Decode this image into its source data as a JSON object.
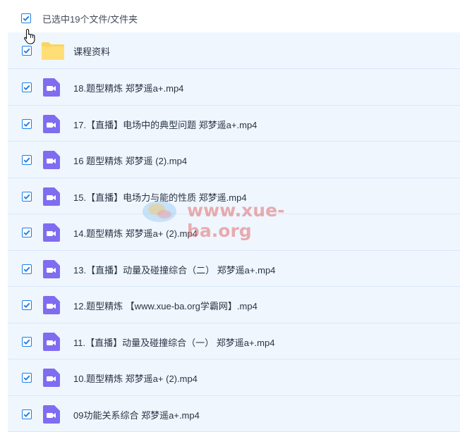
{
  "header": {
    "select_label": "已选中19个文件/文件夹"
  },
  "files": [
    {
      "name": "课程资料",
      "type": "folder"
    },
    {
      "name": "18.题型精炼 郑梦遥a+.mp4",
      "type": "video"
    },
    {
      "name": "17.【直播】电场中的典型问题 郑梦遥a+.mp4",
      "type": "video"
    },
    {
      "name": "16 题型精炼 郑梦遥 (2).mp4",
      "type": "video"
    },
    {
      "name": "15.【直播】电场力与能的性质 郑梦遥.mp4",
      "type": "video"
    },
    {
      "name": "14.题型精炼 郑梦遥a+ (2).mp4",
      "type": "video"
    },
    {
      "name": "13.【直播】动量及碰撞综合（二） 郑梦遥a+.mp4",
      "type": "video"
    },
    {
      "name": "12.题型精炼 【www.xue-ba.org学霸网】.mp4",
      "type": "video"
    },
    {
      "name": "11.【直播】动量及碰撞综合（一） 郑梦遥a+.mp4",
      "type": "video"
    },
    {
      "name": "10.题型精炼 郑梦遥a+ (2).mp4",
      "type": "video"
    },
    {
      "name": "09功能关系综合 郑梦遥a+.mp4",
      "type": "video"
    }
  ],
  "watermark": {
    "text": "www.xue-ba.org"
  },
  "colors": {
    "checkbox": "#1f7fe5",
    "row_bg": "#eff6fe",
    "video_icon": "#7f6cf1",
    "folder_icon": "#fcd460"
  }
}
